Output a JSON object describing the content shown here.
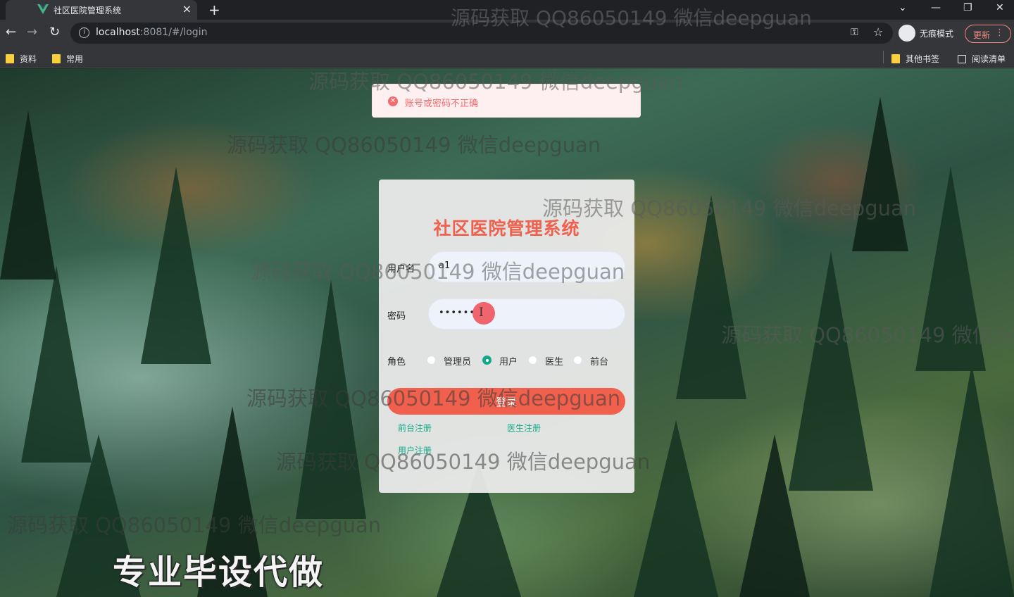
{
  "browser": {
    "tab_title": "社区医院管理系统",
    "tab_close": "×",
    "new_tab": "+",
    "url_host": "localhost",
    "url_rest": ":8081/#/login",
    "incognito_label": "无痕模式",
    "update_label": "更新",
    "bookmarks": [
      "资料",
      "常用"
    ],
    "bookmarks_right": [
      "其他书签",
      "阅读清单"
    ]
  },
  "message": {
    "error_text": "账号或密码不正确"
  },
  "login": {
    "title": "社区医院管理系统",
    "username_label": "用户名",
    "username_value": "a1",
    "password_label": "密码",
    "password_value": "••••••",
    "role_label": "角色",
    "roles": [
      "管理员",
      "用户",
      "医生",
      "前台"
    ],
    "selected_role": "用户",
    "login_button": "登录",
    "links": [
      "前台注册",
      "医生注册",
      "用户注册"
    ]
  },
  "watermark_text": "源码获取 QQ86050149 微信deepguan",
  "promo_text": "专业毕设代做",
  "colors": {
    "accent": "#f0604d",
    "link": "#13a88a",
    "error": "#f56c6c"
  }
}
